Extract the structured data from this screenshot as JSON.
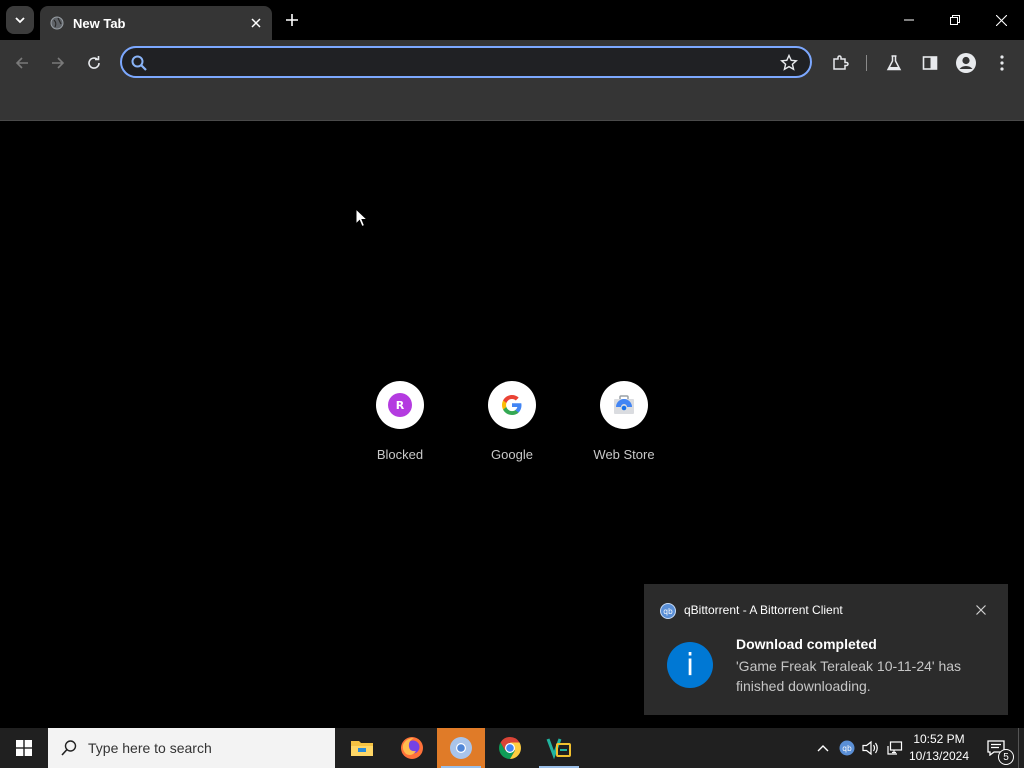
{
  "browser": {
    "tab": {
      "title": "New Tab"
    },
    "omnibox": {
      "value": "",
      "placeholder": ""
    },
    "icons": {
      "tab_search": "chevron-down-icon",
      "favicon": "globe-icon",
      "close": "close-icon",
      "new_tab": "plus-icon",
      "back": "arrow-left-icon",
      "forward": "arrow-right-icon",
      "reload": "reload-icon",
      "bookmark": "star-icon",
      "extensions": "puzzle-icon",
      "labs": "flask-icon",
      "side_panel": "side-panel-icon",
      "profile": "account-icon",
      "menu": "kebab-icon"
    }
  },
  "shortcuts": [
    {
      "label": "Blocked",
      "icon": "letter-r-icon",
      "letter": "R",
      "color": "#b43be0"
    },
    {
      "label": "Google",
      "icon": "google-logo-icon"
    },
    {
      "label": "Web Store",
      "icon": "web-store-icon"
    }
  ],
  "notification": {
    "app_name": "qBittorrent - A Bittorrent Client",
    "title": "Download completed",
    "body": "'Game Freak Teraleak 10-11-24' has finished downloading.",
    "info_glyph": "i",
    "accent": "#0078d4"
  },
  "taskbar": {
    "search_placeholder": "Type here to search",
    "apps": [
      {
        "name": "File Explorer",
        "icon": "folder-icon"
      },
      {
        "name": "Firefox",
        "icon": "firefox-icon"
      },
      {
        "name": "Chromium",
        "icon": "chromium-icon",
        "active": true
      },
      {
        "name": "Google Chrome",
        "icon": "chrome-icon"
      },
      {
        "name": "Visual Studio Code",
        "icon": "vscode-icon"
      }
    ],
    "clock": {
      "time": "10:52 PM",
      "date": "10/13/2024"
    },
    "notification_count": "5"
  }
}
